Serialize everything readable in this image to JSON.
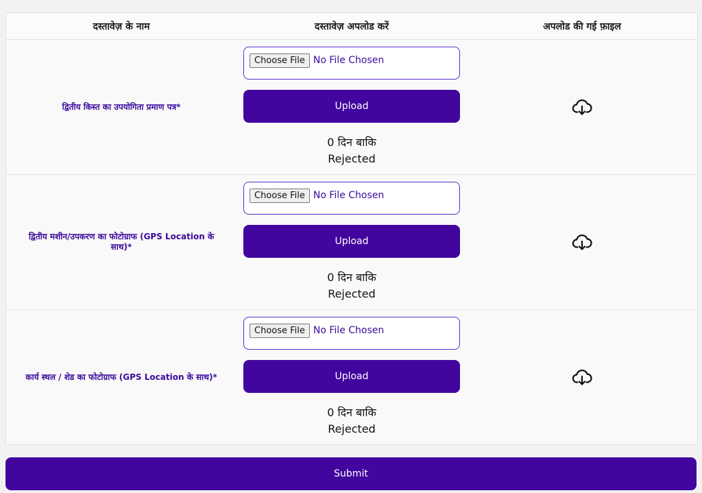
{
  "table": {
    "headers": [
      "दस्तावेज़ के नाम",
      "दस्तावेज़ अपलोड करें",
      "अपलोड की गई फ़ाइल"
    ],
    "rows": [
      {
        "name": "द्वितीय किस्त का उपयोगिता प्रमाण पत्र*",
        "choose_label": "Choose File",
        "file_status": "No File Chosen",
        "upload_label": "Upload",
        "days_left": "0 दिन बाकि",
        "status": "Rejected",
        "icon": "cloud-download-icon"
      },
      {
        "name": "द्वितीय मशीन/उपकरण का फोटोग्राफ (GPS Location के साथ)*",
        "choose_label": "Choose File",
        "file_status": "No File Chosen",
        "upload_label": "Upload",
        "days_left": "0 दिन बाकि",
        "status": "Rejected",
        "icon": "cloud-download-icon"
      },
      {
        "name": "कार्य स्थल / शेड का फोटोग्राफ (GPS Location के साथ)*",
        "choose_label": "Choose File",
        "file_status": "No File Chosen",
        "upload_label": "Upload",
        "days_left": "0 दिन बाकि",
        "status": "Rejected",
        "icon": "cloud-download-icon"
      }
    ]
  },
  "submit_label": "Submit",
  "colors": {
    "primary": "#42059e",
    "doc_name": "#3b0a9c",
    "border": "#5b2bd0",
    "background": "#f2f2f2"
  }
}
